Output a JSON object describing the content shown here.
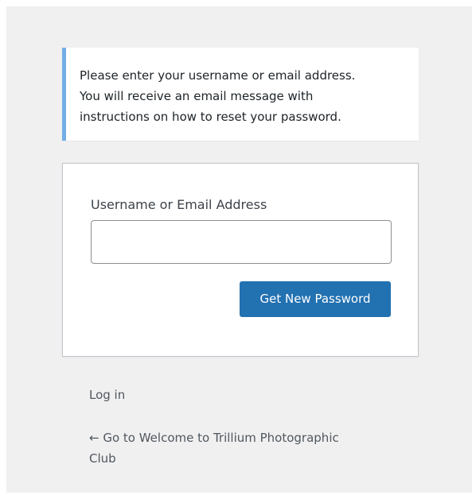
{
  "colors": {
    "page_background": "#f0f0f1",
    "notice_border": "#72aee6",
    "primary_button": "#2271b1",
    "button_text": "#ffffff",
    "text": "#3c434a",
    "link_text": "#50575e"
  },
  "message": {
    "lines": [
      "Please enter your username or email address.",
      "You will receive an email message with",
      "instructions on how to reset your password."
    ]
  },
  "form": {
    "field_label": "Username or Email Address",
    "field_value": "",
    "field_placeholder": "",
    "submit_label": "Get New Password"
  },
  "nav": {
    "login_label": "Log in",
    "back_link_lines": [
      "← Go to Welcome to Trillium Photographic",
      "Club"
    ]
  }
}
